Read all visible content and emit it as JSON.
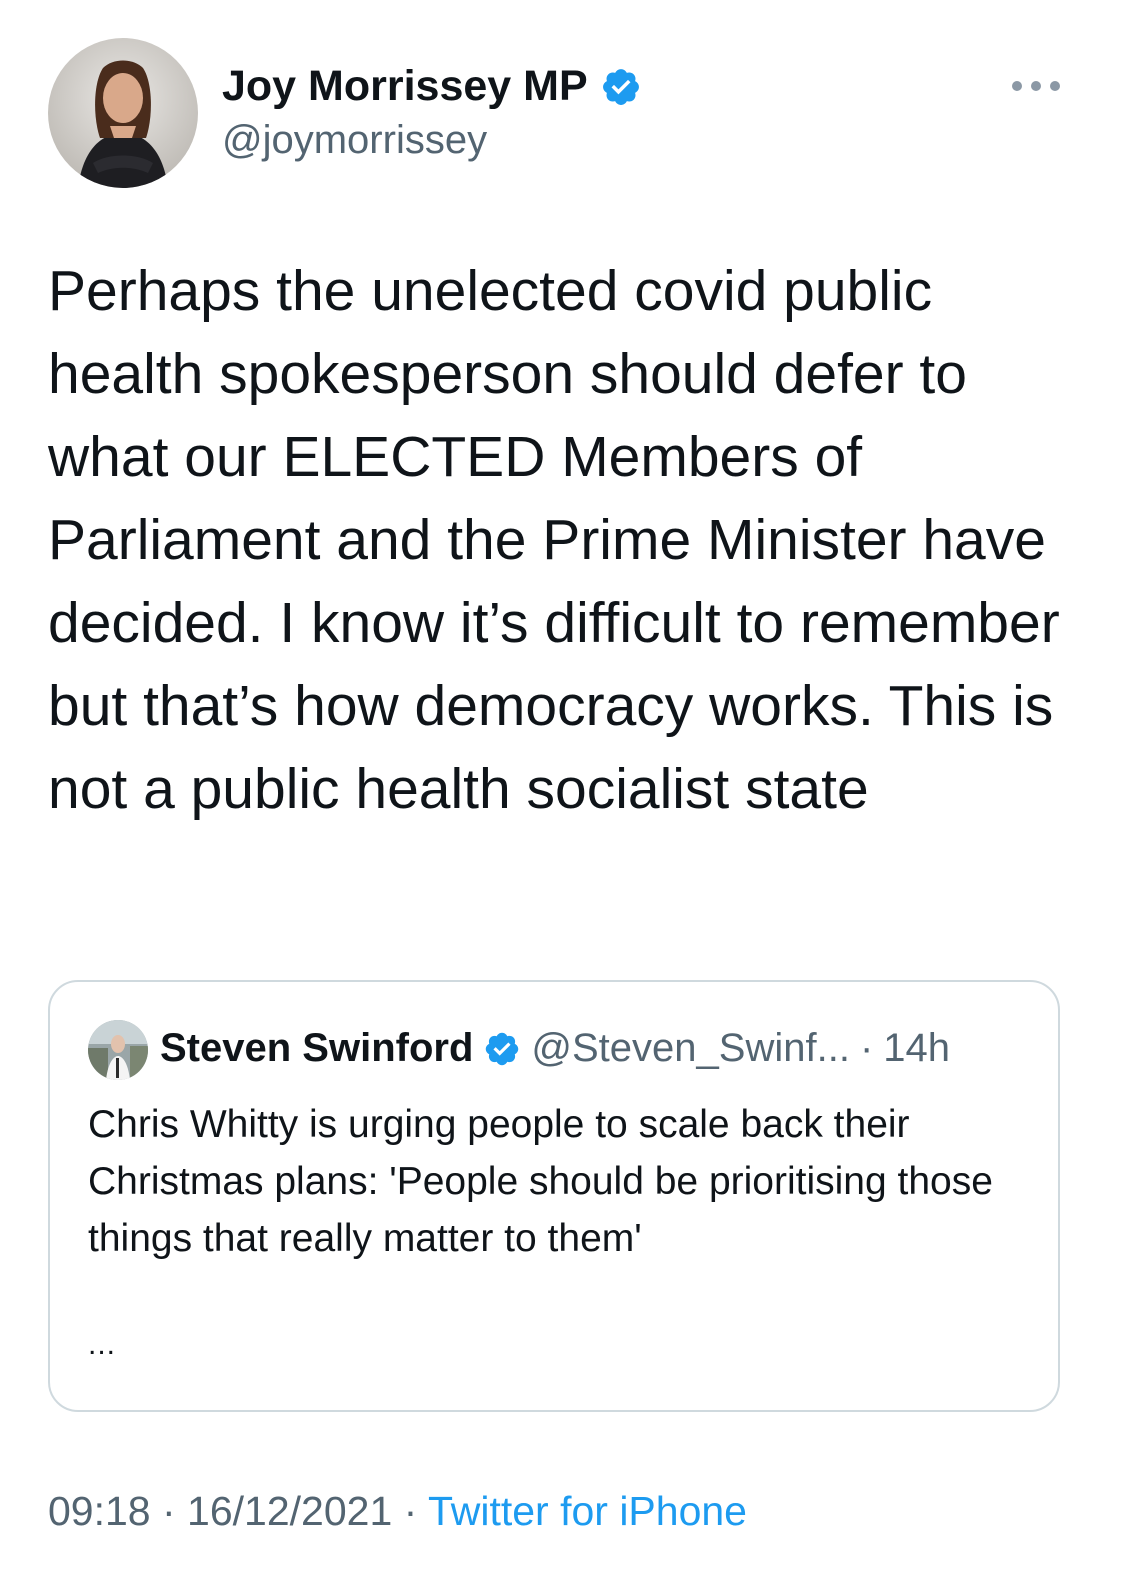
{
  "author": {
    "name": "Joy Morrissey MP",
    "handle": "@joymorrissey",
    "verified": true,
    "avatar_icon": "profile-photo"
  },
  "more_icon": "more-options-icon",
  "tweet": {
    "text": "Perhaps the unelected covid public health spokesperson should defer to what our ELECTED Members of Parliament and the Prime Minister have decided. I know it’s difficult to remember but that’s how democracy works. This is not a public health socialist state"
  },
  "quoted": {
    "name": "Steven Swinford",
    "handle": "@Steven_Swinf...",
    "separator": "·",
    "time": "14h",
    "verified": true,
    "text": "Chris Whitty is urging people to scale back their Christmas plans: 'People should be prioritising those things that really matter to them'",
    "more": "..."
  },
  "meta": {
    "time": "09:18",
    "separator1": " · ",
    "date": "16/12/2021",
    "separator2": " · ",
    "source": "Twitter for iPhone"
  },
  "colors": {
    "verified_badge": "#1d9bf0",
    "link": "#1d9bf0",
    "secondary_text": "#536471",
    "border": "#cfd9de"
  }
}
